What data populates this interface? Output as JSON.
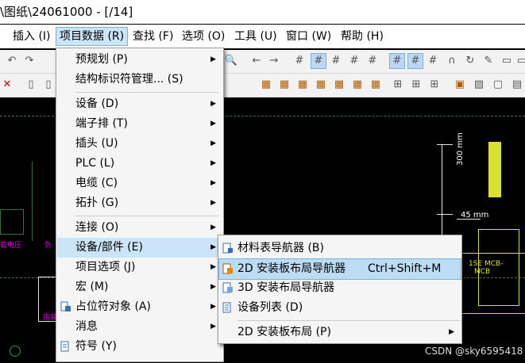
{
  "title": "\\图纸\\24061000 - [/14]",
  "menubar": [
    {
      "label": "插入 (I)"
    },
    {
      "label": "项目数据 (R)"
    },
    {
      "label": "查找 (F)"
    },
    {
      "label": "选项 (O)"
    },
    {
      "label": "工具 (U)"
    },
    {
      "label": "窗口 (W)"
    },
    {
      "label": "帮助 (H)"
    }
  ],
  "dropdown": [
    {
      "label": "预规划 (P)",
      "arrow": "▶"
    },
    {
      "label": "结构标识符管理... (S)",
      "arrow": ""
    },
    {
      "label": "设备 (D)",
      "arrow": "▶"
    },
    {
      "label": "端子排 (T)",
      "arrow": "▶"
    },
    {
      "label": "插头 (U)",
      "arrow": "▶"
    },
    {
      "label": "PLC (L)",
      "arrow": "▶"
    },
    {
      "label": "电缆 (C)",
      "arrow": "▶"
    },
    {
      "label": "拓扑 (G)",
      "arrow": "▶"
    },
    {
      "label": "连接 (O)",
      "arrow": "▶"
    },
    {
      "label": "设备/部件 (E)",
      "arrow": "▶"
    },
    {
      "label": "项目选项 (J)",
      "arrow": "▶"
    },
    {
      "label": "宏 (M)",
      "arrow": "▶"
    },
    {
      "label": "占位符对象 (A)",
      "arrow": "▶"
    },
    {
      "label": "消息",
      "arrow": "▶"
    },
    {
      "label": "符号 (Y)",
      "arrow": ""
    }
  ],
  "submenu": [
    {
      "label": "材料表导航器 (B)",
      "shortcut": "",
      "arrow": ""
    },
    {
      "label": "2D 安装板布局导航器",
      "shortcut": "Ctrl+Shift+M",
      "arrow": ""
    },
    {
      "label": "3D 安装布局导航器",
      "shortcut": "",
      "arrow": ""
    },
    {
      "label": "设备列表 (D)",
      "shortcut": "",
      "arrow": ""
    },
    {
      "label": "2D 安装板布局 (P)",
      "shortcut": "",
      "arrow": "▶"
    }
  ],
  "canvas": {
    "dim_vertical": "300 mm",
    "dim_horizontal": "45 mm",
    "label_left1": "载电压",
    "label_left2": "负",
    "label_bottom": "指装",
    "label_right1": "1SE MCB-",
    "label_right2": "MCB"
  },
  "watermark": "CSDN @sky6595418",
  "colors": {
    "highlight": "#cce4f7",
    "menu_bg": "#f5f5f5",
    "canvas_bg": "#000000",
    "label_magenta": "#e000e0"
  }
}
